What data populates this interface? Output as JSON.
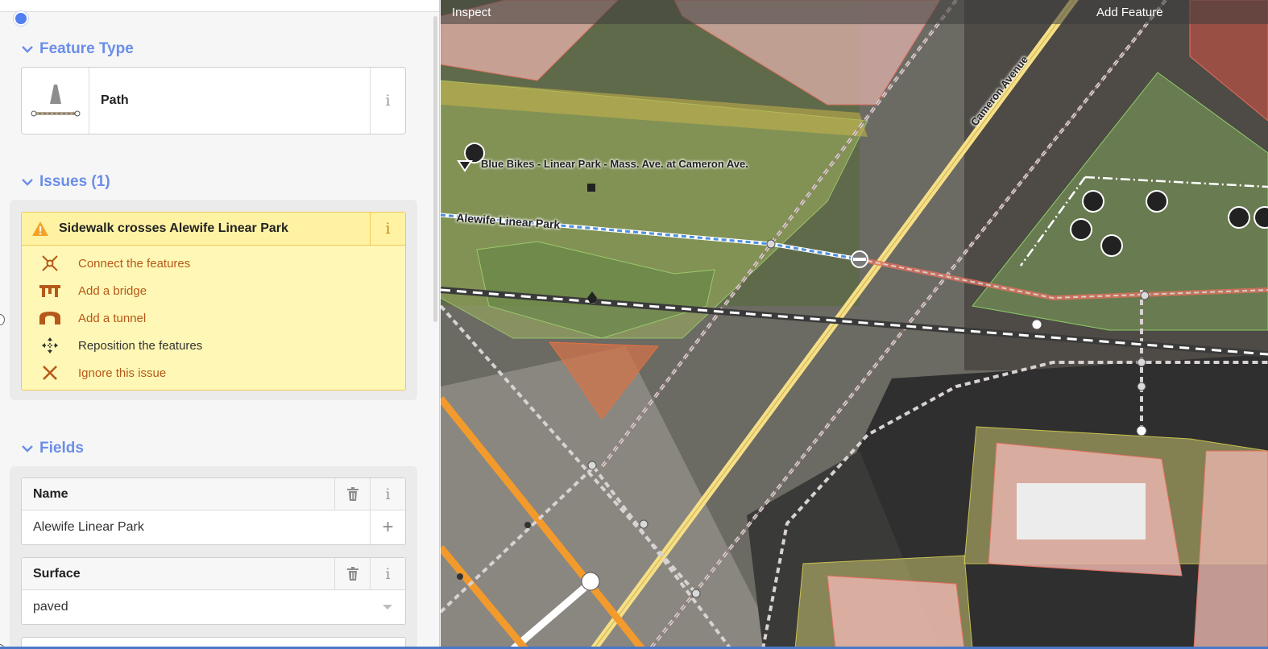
{
  "sidebar": {
    "feature_type": {
      "heading": "Feature Type",
      "preset_name": "Path",
      "preset_icon": "path-icon",
      "info": "i"
    },
    "issues": {
      "heading": "Issues (1)",
      "issue_title": "Sidewalk crosses Alewife Linear Park",
      "issue_icon": "warning-icon",
      "info": "i",
      "fixes": [
        {
          "label": "Connect the features",
          "icon": "connect-icon"
        },
        {
          "label": "Add a bridge",
          "icon": "bridge-icon"
        },
        {
          "label": "Add a tunnel",
          "icon": "tunnel-icon"
        },
        {
          "label": "Reposition the features",
          "icon": "move-icon"
        },
        {
          "label": "Ignore this issue",
          "icon": "close-icon"
        }
      ]
    },
    "fields": {
      "heading": "Fields",
      "items": [
        {
          "label": "Name",
          "value": "Alewife Linear Park",
          "info": "i",
          "action": "+"
        },
        {
          "label": "Surface",
          "value": "paved",
          "info": "i"
        }
      ]
    }
  },
  "map": {
    "toolbar": {
      "inspect": "Inspect",
      "add_feature": "Add Feature"
    },
    "labels": {
      "poi": "Blue Bikes - Linear Park - Mass. Ave. at Cameron Ave.",
      "path": "Alewife Linear Park",
      "street": "Cameron Avenue"
    },
    "colors": {
      "accent": "#6a8ee8",
      "warning_bg": "#fff7b5",
      "fix_text": "#b5591a",
      "selected_path": "#4b90e2"
    }
  }
}
